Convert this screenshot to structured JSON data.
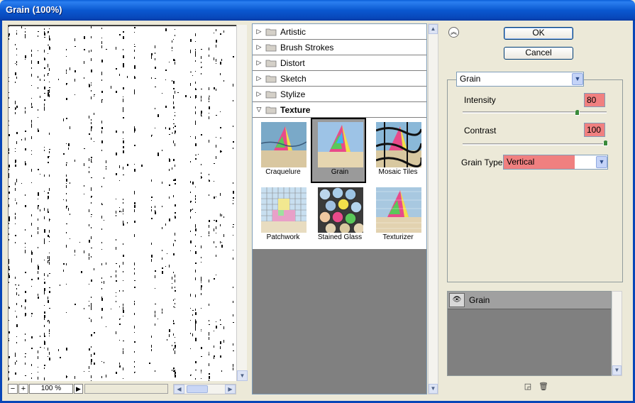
{
  "window": {
    "title": "Grain (100%)"
  },
  "preview": {
    "zoom_out": "−",
    "zoom_in": "+",
    "zoom_value": "100 %",
    "zoom_menu": "▶"
  },
  "categories": [
    {
      "label": "Artistic",
      "open": false
    },
    {
      "label": "Brush Strokes",
      "open": false
    },
    {
      "label": "Distort",
      "open": false
    },
    {
      "label": "Sketch",
      "open": false
    },
    {
      "label": "Stylize",
      "open": false
    },
    {
      "label": "Texture",
      "open": true
    }
  ],
  "texture_filters": [
    {
      "label": "Craquelure",
      "selected": false
    },
    {
      "label": "Grain",
      "selected": true
    },
    {
      "label": "Mosaic Tiles",
      "selected": false
    },
    {
      "label": "Patchwork",
      "selected": false
    },
    {
      "label": "Stained Glass",
      "selected": false
    },
    {
      "label": "Texturizer",
      "selected": false
    }
  ],
  "buttons": {
    "ok": "OK",
    "cancel": "Cancel"
  },
  "settings": {
    "filter": "Grain",
    "intensity": {
      "label": "Intensity",
      "value": "80",
      "level": 80
    },
    "contrast": {
      "label": "Contrast",
      "value": "100",
      "level": 100
    },
    "grain_type": {
      "label": "Grain Type:",
      "value": "Vertical"
    },
    "highlight_color": "#f08080"
  },
  "layers": [
    {
      "name": "Grain",
      "visible": true
    }
  ]
}
